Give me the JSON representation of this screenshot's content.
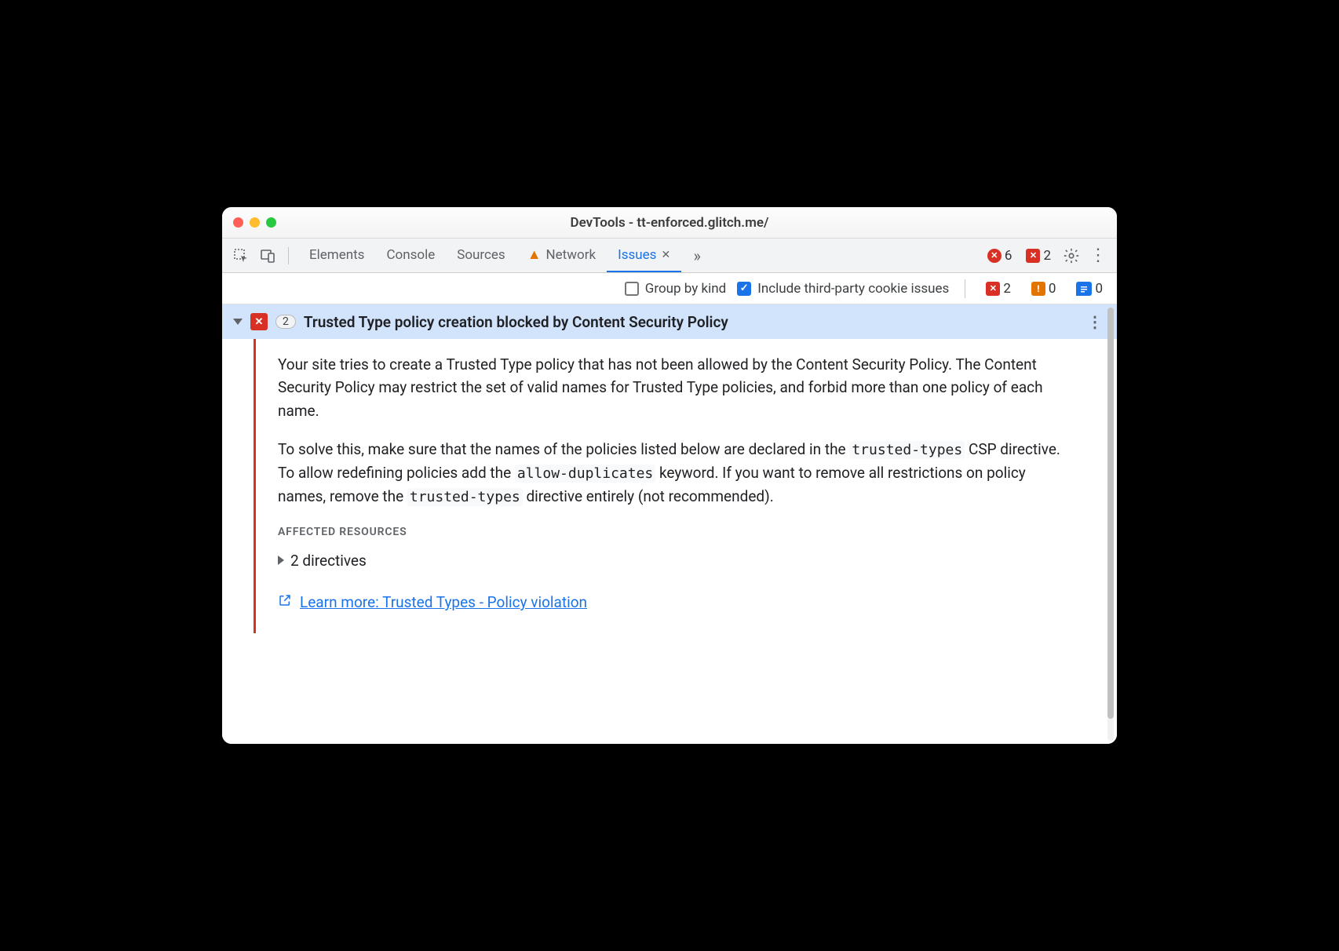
{
  "window": {
    "title": "DevTools - tt-enforced.glitch.me/"
  },
  "tabs": {
    "items": [
      {
        "label": "Elements"
      },
      {
        "label": "Console"
      },
      {
        "label": "Sources"
      },
      {
        "label": "Network",
        "has_warning": true
      },
      {
        "label": "Issues",
        "active": true,
        "closable": true
      }
    ]
  },
  "badges": {
    "errors": "6",
    "page_errors": "2",
    "toolbar_page_errors": "2",
    "toolbar_breaking": "0",
    "toolbar_info": "0"
  },
  "toolbar": {
    "group_by_kind": {
      "label": "Group by kind",
      "checked": false
    },
    "third_party": {
      "label": "Include third-party cookie issues",
      "checked": true
    }
  },
  "issue": {
    "count": "2",
    "title": "Trusted Type policy creation blocked by Content Security Policy",
    "p1_a": "Your site tries to create a Trusted Type policy that has not been allowed by the Content Security Policy. The Content Security Policy may restrict the set of valid names for Trusted Type policies, and forbid more than one policy of each name.",
    "p2_a": "To solve this, make sure that the names of the policies listed below are declared in the ",
    "code1": "trusted-types",
    "p2_b": " CSP directive. To allow redefining policies add the ",
    "code2": "allow-duplicates",
    "p2_c": " keyword. If you want to remove all restrictions on policy names, remove the ",
    "code3": "trusted-types",
    "p2_d": " directive entirely (not recommended).",
    "affected_label": "AFFECTED RESOURCES",
    "directives": "2 directives",
    "learn_more": "Learn more: Trusted Types - Policy violation"
  }
}
